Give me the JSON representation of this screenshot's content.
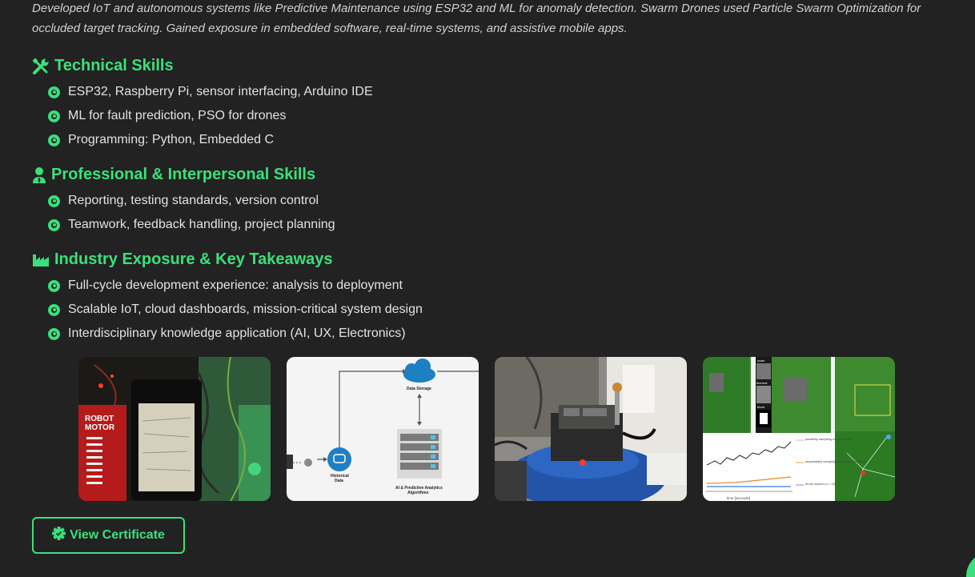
{
  "intro_text": "Developed IoT and autonomous systems like Predictive Maintenance using ESP32 and ML for anomaly detection. Swarm Drones used Particle Swarm Optimization for occluded target tracking. Gained exposure in embedded software, real-time systems, and assistive mobile apps.",
  "accent_color": "#3be07a",
  "sections": [
    {
      "title": "Technical Skills",
      "icon": "tools-icon",
      "items": [
        "ESP32, Raspberry Pi, sensor interfacing, Arduino IDE",
        "ML for fault prediction, PSO for drones",
        "Programming: Python, Embedded C"
      ]
    },
    {
      "title": "Professional & Interpersonal Skills",
      "icon": "user-tie-icon",
      "items": [
        "Reporting, testing standards, version control",
        "Teamwork, feedback handling, project planning"
      ]
    },
    {
      "title": "Industry Exposure & Key Takeaways",
      "icon": "industry-icon",
      "items": [
        "Full-cycle development experience: analysis to deployment",
        "Scalable IoT, cloud dashboards, mission-critical system design",
        "Interdisciplinary knowledge application (AI, UX, Electronics)"
      ]
    }
  ],
  "gallery": {
    "robot_label_1": "ROBOT",
    "robot_label_2": "MOTOR",
    "diagram_storage": "Data Storage",
    "diagram_historical_1": "Historical",
    "diagram_historical_2": "Data",
    "diagram_ai_1": "AI & Predictive Analytics",
    "diagram_ai_2": "Algorithms",
    "plot_label_a": "scale",
    "plot_label_b": "thermal",
    "plot_label_c": "block",
    "plot_legend_1": "parallelly sampling camera array",
    "plot_legend_2": "sequentially sampling single camera drone",
    "plot_legend_3": "drone swarm (n = 10)",
    "plot_xlabel": "time [seconds]"
  },
  "certificate_button": "View Certificate"
}
